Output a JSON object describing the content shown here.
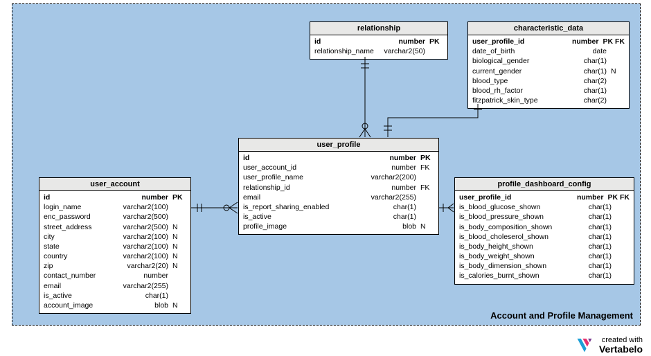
{
  "region_title": "Account and Profile Management",
  "footer": {
    "line1": "created with",
    "line2": "Vertabelo"
  },
  "entities": {
    "relationship": {
      "title": "relationship",
      "cols": [
        {
          "name": "id",
          "type": "number",
          "flags": "PK",
          "bold": true
        },
        {
          "name": "relationship_name",
          "type": "varchar2(50)",
          "flags": ""
        }
      ]
    },
    "characteristic_data": {
      "title": "characteristic_data",
      "cols": [
        {
          "name": "user_profile_id",
          "type": "number",
          "flags": "PK FK",
          "bold": true
        },
        {
          "name": "date_of_birth",
          "type": "date",
          "flags": ""
        },
        {
          "name": "biological_gender",
          "type": "char(1)",
          "flags": ""
        },
        {
          "name": "current_gender",
          "type": "char(1)",
          "flags": "N"
        },
        {
          "name": "blood_type",
          "type": "char(2)",
          "flags": ""
        },
        {
          "name": "blood_rh_factor",
          "type": "char(1)",
          "flags": ""
        },
        {
          "name": "fitzpatrick_skin_type",
          "type": "char(2)",
          "flags": ""
        }
      ]
    },
    "user_profile": {
      "title": "user_profile",
      "cols": [
        {
          "name": "id",
          "type": "number",
          "flags": "PK",
          "bold": true
        },
        {
          "name": "user_account_id",
          "type": "number",
          "flags": "FK"
        },
        {
          "name": "user_profile_name",
          "type": "varchar2(200)",
          "flags": ""
        },
        {
          "name": "relationship_id",
          "type": "number",
          "flags": "FK"
        },
        {
          "name": "email",
          "type": "varchar2(255)",
          "flags": ""
        },
        {
          "name": "is_report_sharing_enabled",
          "type": "char(1)",
          "flags": ""
        },
        {
          "name": "is_active",
          "type": "char(1)",
          "flags": ""
        },
        {
          "name": "profile_image",
          "type": "blob",
          "flags": "N"
        }
      ]
    },
    "user_account": {
      "title": "user_account",
      "cols": [
        {
          "name": "id",
          "type": "number",
          "flags": "PK",
          "bold": true
        },
        {
          "name": "login_name",
          "type": "varchar2(100)",
          "flags": ""
        },
        {
          "name": "enc_password",
          "type": "varchar2(500)",
          "flags": ""
        },
        {
          "name": "street_address",
          "type": "varchar2(500)",
          "flags": "N"
        },
        {
          "name": "city",
          "type": "varchar2(100)",
          "flags": "N"
        },
        {
          "name": "state",
          "type": "varchar2(100)",
          "flags": "N"
        },
        {
          "name": "country",
          "type": "varchar2(100)",
          "flags": "N"
        },
        {
          "name": "zip",
          "type": "varchar2(20)",
          "flags": "N"
        },
        {
          "name": "contact_number",
          "type": "number",
          "flags": ""
        },
        {
          "name": "email",
          "type": "varchar2(255)",
          "flags": ""
        },
        {
          "name": "is_active",
          "type": "char(1)",
          "flags": ""
        },
        {
          "name": "account_image",
          "type": "blob",
          "flags": "N"
        }
      ]
    },
    "profile_dashboard_config": {
      "title": "profile_dashboard_config",
      "cols": [
        {
          "name": "user_profile_id",
          "type": "number",
          "flags": "PK FK",
          "bold": true
        },
        {
          "name": "is_blood_glucose_shown",
          "type": "char(1)",
          "flags": ""
        },
        {
          "name": "is_blood_pressure_shown",
          "type": "char(1)",
          "flags": ""
        },
        {
          "name": "is_body_composition_shown",
          "type": "char(1)",
          "flags": ""
        },
        {
          "name": "is_blood_choleserol_shown",
          "type": "char(1)",
          "flags": ""
        },
        {
          "name": "is_body_height_shown",
          "type": "char(1)",
          "flags": ""
        },
        {
          "name": "is_body_weight_shown",
          "type": "char(1)",
          "flags": ""
        },
        {
          "name": "is_body_dimension_shown",
          "type": "char(1)",
          "flags": ""
        },
        {
          "name": "is_calories_burnt_shown",
          "type": "char(1)",
          "flags": ""
        }
      ]
    }
  }
}
